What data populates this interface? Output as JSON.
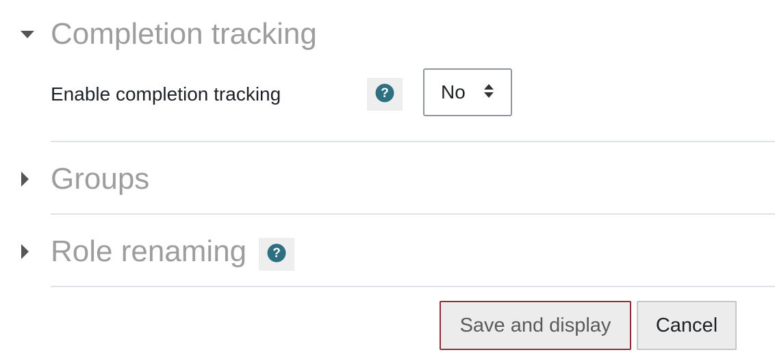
{
  "sections": {
    "completion": {
      "title": "Completion tracking",
      "expanded": true,
      "toggle_icon": "caret-down-icon"
    },
    "groups": {
      "title": "Groups",
      "expanded": false,
      "toggle_icon": "caret-right-icon"
    },
    "role_renaming": {
      "title": "Role renaming",
      "expanded": false,
      "toggle_icon": "caret-right-icon",
      "help_icon": "question-circle-icon"
    }
  },
  "completion_field": {
    "label": "Enable completion tracking",
    "help_icon": "question-circle-icon",
    "select": {
      "value": "No",
      "icon": "up-down-caret-icon"
    }
  },
  "actions": {
    "save_label": "Save and display",
    "cancel_label": "Cancel"
  },
  "colors": {
    "help_icon": "#2f6f82",
    "section_title": "#9d9d9d",
    "save_border": "#8f2d3a"
  }
}
